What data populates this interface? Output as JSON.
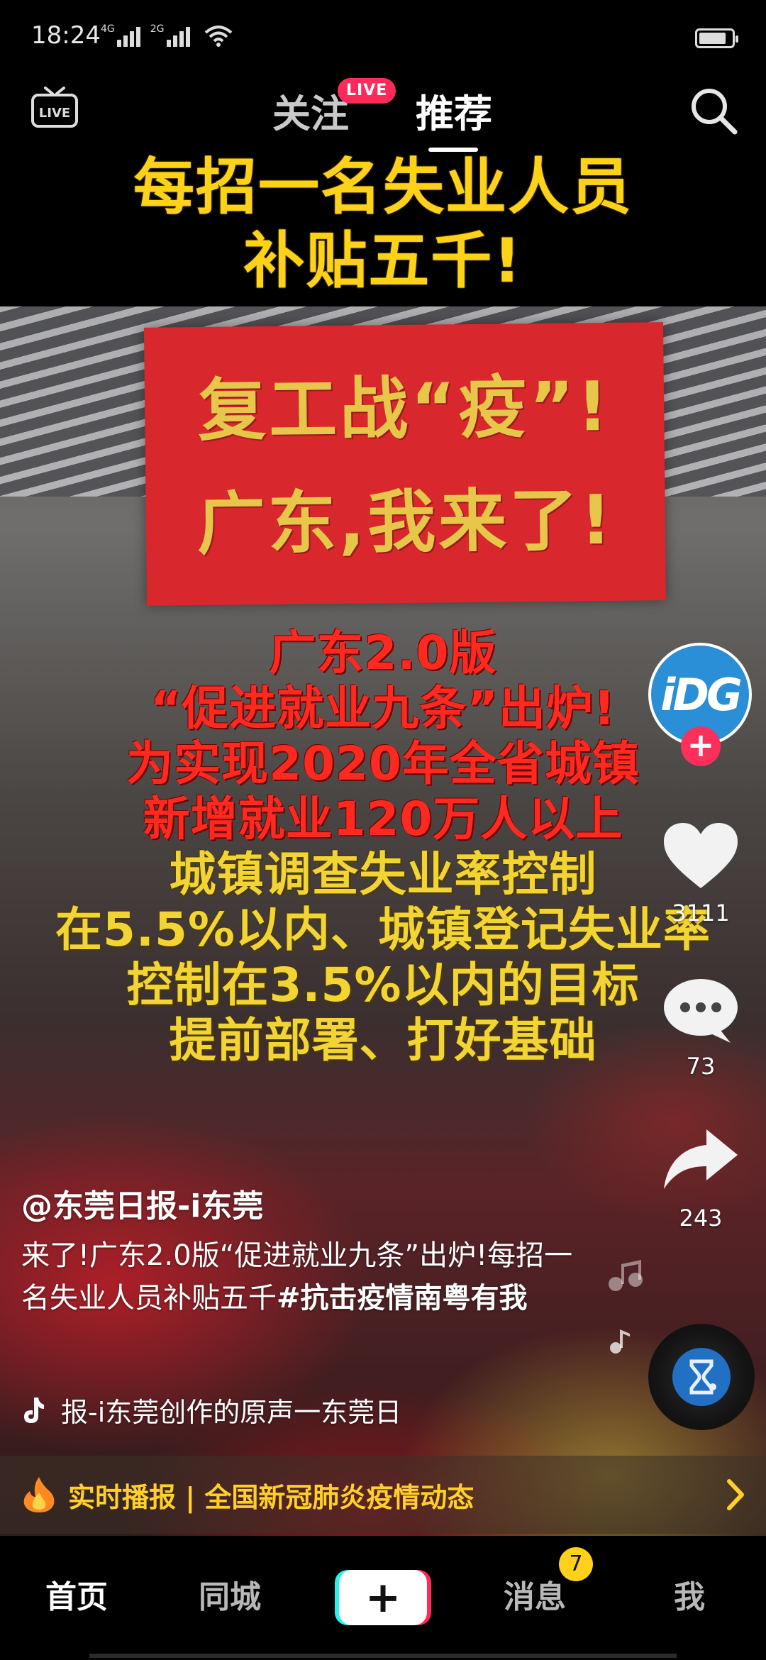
{
  "status_bar": {
    "time": "18:24",
    "network_1": "4G",
    "network_2": "2G",
    "battery_level": 0.85
  },
  "top_nav": {
    "follow_tab": "关注",
    "live_badge": "LIVE",
    "recommend_tab": "推荐",
    "live_icon_label": "LIVE"
  },
  "video": {
    "top_caption": [
      "每招一名失业人员",
      "补贴五千!"
    ],
    "banner": [
      "复工战“疫”!",
      "广东,我来了!"
    ],
    "overlay_lines": [
      {
        "text": "广东2.0版",
        "color": "red"
      },
      {
        "text": "“促进就业九条”出炉!",
        "color": "red"
      },
      {
        "text": "为实现2020年全省城镇",
        "color": "red"
      },
      {
        "text": "新增就业120万人以上",
        "color": "red"
      },
      {
        "text": "城镇调查失业率控制",
        "color": "yellow"
      },
      {
        "text": "在5.5%以内、城镇登记失业率",
        "color": "yellow"
      },
      {
        "text": "控制在3.5%以内的目标",
        "color": "yellow"
      },
      {
        "text": "提前部署、打好基础",
        "color": "yellow"
      }
    ]
  },
  "right_rail": {
    "avatar_text": "iDG",
    "like_count": "3111",
    "comment_count": "73",
    "share_count": "243"
  },
  "caption": {
    "author": "@东莞日报-i东莞",
    "description": "来了!广东2.0版“促进就业九条”出炉!每招一名失业人员补贴五千",
    "hashtag": "#抗击疫情南粤有我",
    "music": "报-i东莞创作的原声一东莞日"
  },
  "live_banner": {
    "text": "实时播报 | 全国新冠肺炎疫情动态"
  },
  "bottom_nav": {
    "home": "首页",
    "city": "同城",
    "create": "+",
    "messages": "消息",
    "messages_badge": "7",
    "me": "我"
  },
  "colors": {
    "accent_pink": "#fe2c55",
    "accent_cyan": "#25f4ee",
    "caption_yellow": "#ffd21a",
    "banner_red": "#d8272d"
  }
}
